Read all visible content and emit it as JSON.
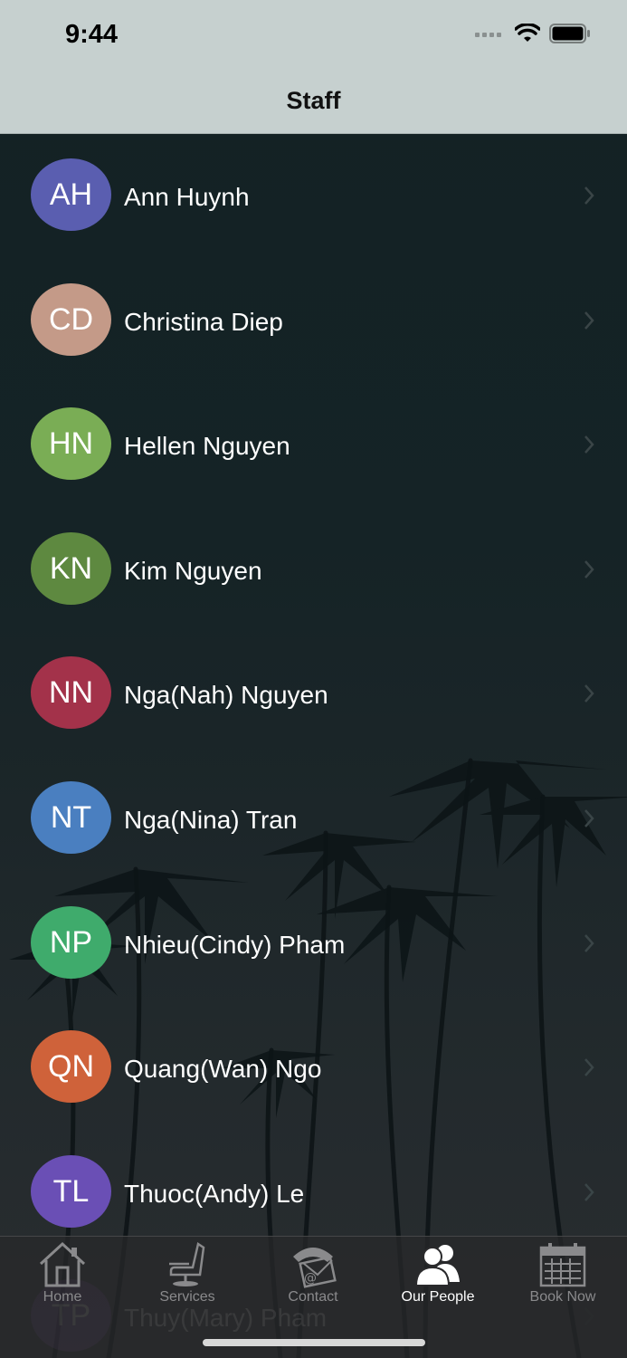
{
  "status": {
    "time": "9:44"
  },
  "nav": {
    "title": "Staff"
  },
  "staff": [
    {
      "initials": "AH",
      "name": "Ann Huynh",
      "color": "#5a5eb0"
    },
    {
      "initials": "CD",
      "name": "Christina Diep",
      "color": "#c49a88"
    },
    {
      "initials": "HN",
      "name": "Hellen Nguyen",
      "color": "#7aad55"
    },
    {
      "initials": "KN",
      "name": "Kim Nguyen",
      "color": "#5e8940"
    },
    {
      "initials": "NN",
      "name": "Nga(Nah) Nguyen",
      "color": "#a3324a"
    },
    {
      "initials": "NT",
      "name": "Nga(Nina) Tran",
      "color": "#4a7fc0"
    },
    {
      "initials": "NP",
      "name": "Nhieu(Cindy) Pham",
      "color": "#3fab6c"
    },
    {
      "initials": "QN",
      "name": "Quang(Wan) Ngo",
      "color": "#cf623a"
    },
    {
      "initials": "TL",
      "name": "Thuoc(Andy) Le",
      "color": "#6a4fb5"
    },
    {
      "initials": "TP",
      "name": "Thuy(Mary) Pham",
      "color": "#7a4fa0"
    }
  ],
  "tabs": [
    {
      "label": "Home",
      "icon": "home-icon",
      "active": false
    },
    {
      "label": "Services",
      "icon": "barber-chair-icon",
      "active": false
    },
    {
      "label": "Contact",
      "icon": "phone-mail-icon",
      "active": false
    },
    {
      "label": "Our People",
      "icon": "people-icon",
      "active": true
    },
    {
      "label": "Book Now",
      "icon": "calendar-icon",
      "active": false
    }
  ]
}
